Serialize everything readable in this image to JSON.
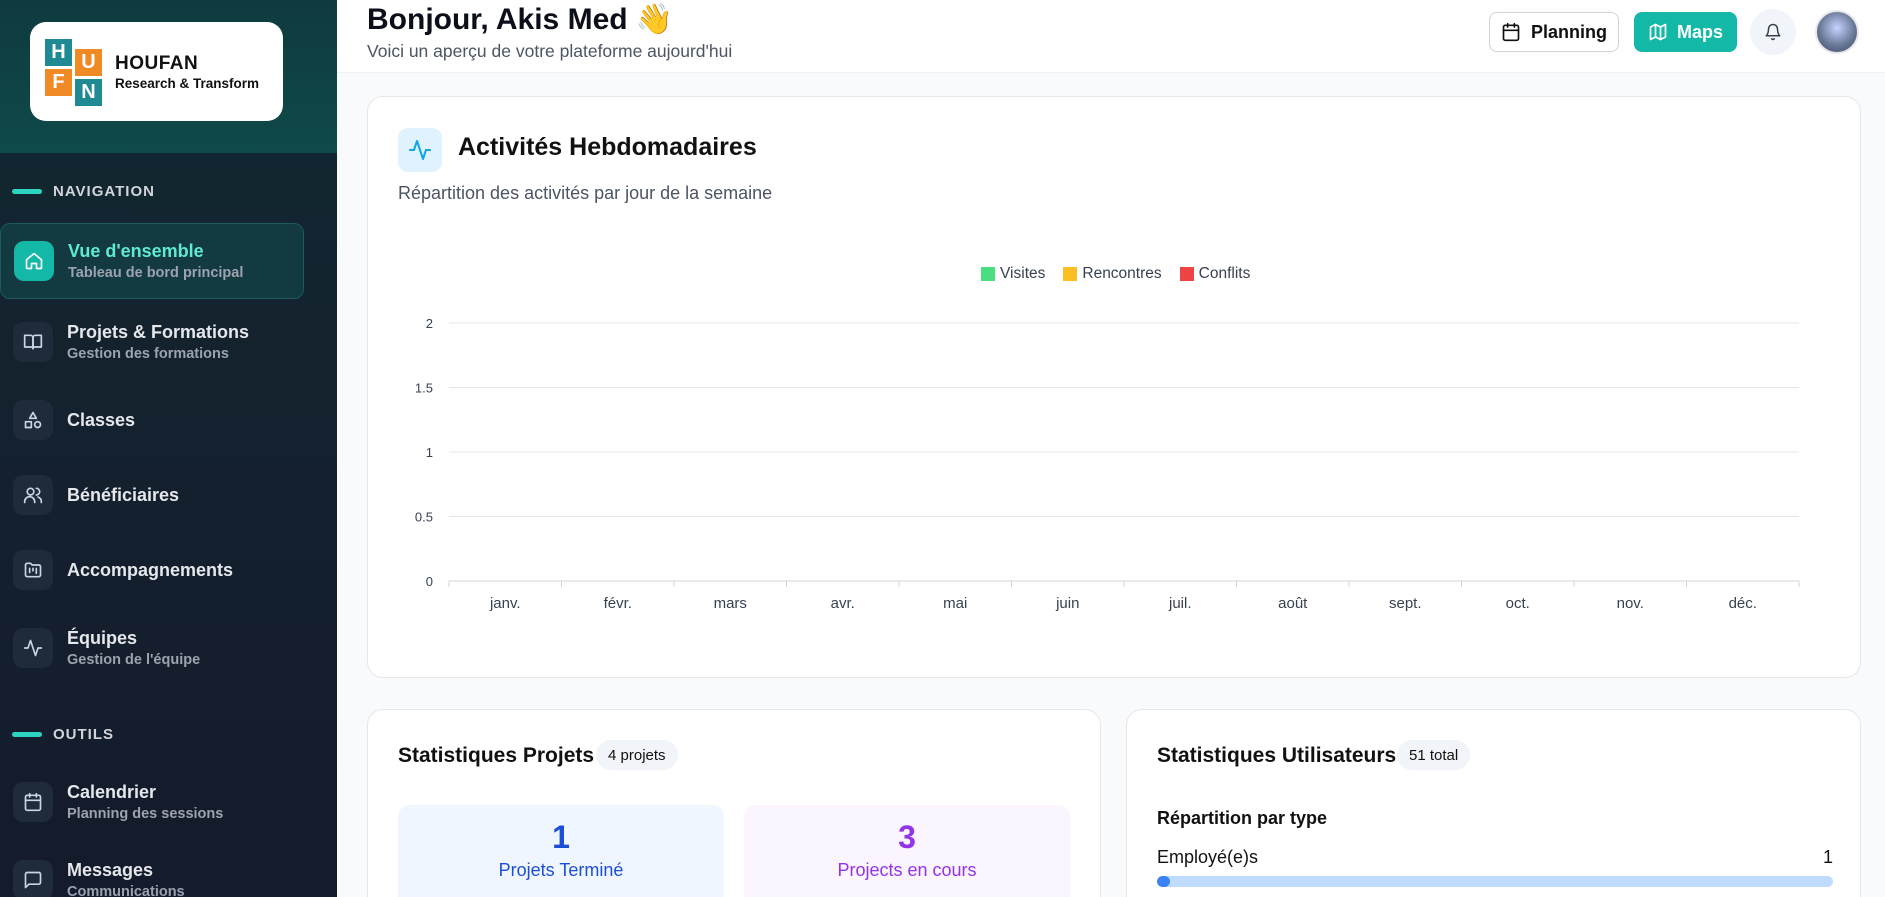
{
  "brand": {
    "letters": [
      "H",
      "U",
      "F",
      "N"
    ],
    "name": "HOUFAN",
    "tagline": "Research & Transform"
  },
  "sidebar": {
    "sections": [
      {
        "label": "NAVIGATION"
      },
      {
        "label": "OUTILS"
      }
    ],
    "items": [
      {
        "title": "Vue d'ensemble",
        "subtitle": "Tableau de bord principal",
        "icon": "home-icon"
      },
      {
        "title": "Projets & Formations",
        "subtitle": "Gestion des formations",
        "icon": "book-open-icon"
      },
      {
        "title": "Classes",
        "subtitle": "",
        "icon": "shapes-icon"
      },
      {
        "title": "Bénéficiaires",
        "subtitle": "",
        "icon": "users-icon"
      },
      {
        "title": "Accompagnements",
        "subtitle": "",
        "icon": "folder-kanban-icon"
      },
      {
        "title": "Équipes",
        "subtitle": "Gestion de l'équipe",
        "icon": "activity-icon"
      },
      {
        "title": "Calendrier",
        "subtitle": "Planning des sessions",
        "icon": "calendar-icon"
      },
      {
        "title": "Messages",
        "subtitle": "Communications",
        "icon": "message-square-icon"
      }
    ]
  },
  "header": {
    "greeting": "Bonjour, Akis Med 👋",
    "subtitle": "Voici un aperçu de votre plateforme aujourd'hui",
    "planning_label": "Planning",
    "maps_label": "Maps"
  },
  "activity_card": {
    "title": "Activités Hebdomadaires",
    "subtitle": "Répartition des activités par jour de la semaine"
  },
  "chart_data": {
    "type": "bar",
    "categories": [
      "janv.",
      "févr.",
      "mars",
      "avr.",
      "mai",
      "juin",
      "juil.",
      "août",
      "sept.",
      "oct.",
      "nov.",
      "déc."
    ],
    "series": [
      {
        "name": "Visites",
        "color": "#4ade80",
        "values": [
          0,
          0,
          0,
          0,
          0,
          0,
          0,
          0,
          0,
          0,
          0,
          0
        ]
      },
      {
        "name": "Rencontres",
        "color": "#fbbf24",
        "values": [
          0,
          0,
          0,
          0,
          0,
          0,
          0,
          0,
          0,
          0,
          0,
          0
        ]
      },
      {
        "name": "Conflits",
        "color": "#ef4444",
        "values": [
          0,
          0,
          0,
          0,
          0,
          0,
          0,
          0,
          0,
          0,
          0,
          0
        ]
      }
    ],
    "yticks": [
      "0",
      "0.5",
      "1",
      "1.5",
      "2"
    ],
    "ylim": [
      0,
      2
    ],
    "grid": true,
    "legend_position": "top-center"
  },
  "projects_stats": {
    "title": "Statistiques Projets",
    "badge": "4 projets",
    "kpis": [
      {
        "value": "1",
        "label": "Projets Terminé",
        "color": "#1d4ed8",
        "bg": "#eff6ff"
      },
      {
        "value": "3",
        "label": "Projects en cours",
        "color": "#9333ea",
        "bg": "#faf5ff"
      }
    ]
  },
  "users_stats": {
    "title": "Statistiques Utilisateurs",
    "badge": "51 total",
    "section": "Répartition par type",
    "rows": [
      {
        "label": "Employé(e)s",
        "value": "1",
        "fraction": 0.0196
      }
    ]
  }
}
